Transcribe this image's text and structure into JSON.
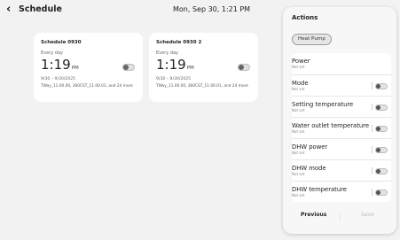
{
  "header": {
    "back_icon": "chevron-left-icon",
    "title": "Schedule",
    "datetime": "Mon, Sep 30, 1:21 PM"
  },
  "schedules": [
    {
      "name": "Schedule 0930",
      "repeat": "Every day",
      "time": "1:19",
      "ampm": "PM",
      "range": "9/30 – 9/30/2025",
      "details": "TWay_11.00.00, 360CST_11.00.01, and 24 more",
      "enabled": false
    },
    {
      "name": "Schedule 0930 2",
      "repeat": "Every day",
      "time": "1:19",
      "ampm": "PM",
      "range": "9/30 – 9/30/2025",
      "details": "TWay_11.00.00, 360CST_11.00.01, and 24 more",
      "enabled": false
    }
  ],
  "actions_panel": {
    "title": "Actions",
    "device_chip": "Heat Pump",
    "rows": [
      {
        "label": "Power",
        "sub": "Not set",
        "has_toggle": false
      },
      {
        "label": "Mode",
        "sub": "Not set",
        "has_toggle": true
      },
      {
        "label": "Setting temperature",
        "sub": "Not set",
        "has_toggle": true
      },
      {
        "label": "Water outlet temperature",
        "sub": "Not set",
        "has_toggle": true
      },
      {
        "label": "DHW power",
        "sub": "Not set",
        "has_toggle": true
      },
      {
        "label": "DHW mode",
        "sub": "Not set",
        "has_toggle": true
      },
      {
        "label": "DHW temperature",
        "sub": "Not set",
        "has_toggle": true
      }
    ],
    "previous_label": "Previous",
    "save_label": "Save"
  }
}
